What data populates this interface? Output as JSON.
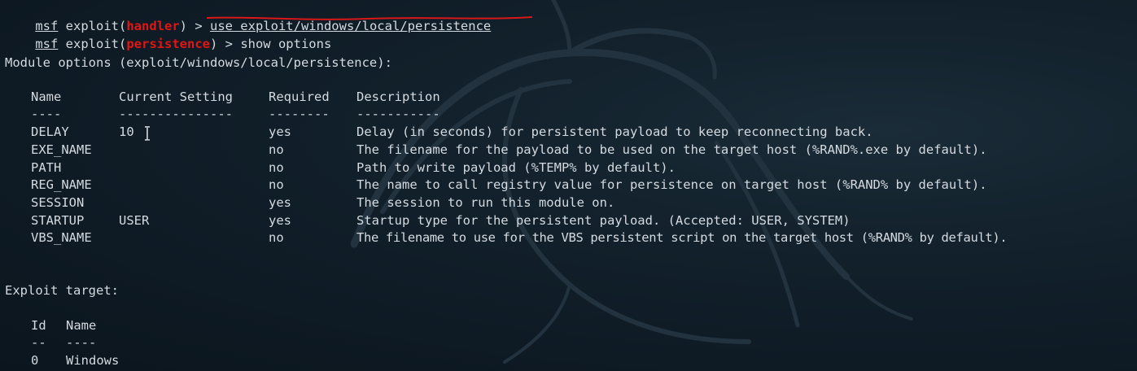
{
  "terminal": {
    "cmd1": {
      "prompt": "msf",
      "pre": " exploit(",
      "module": "handler",
      "post": ") > ",
      "command": "use exploit/windows/local/persistence"
    },
    "cmd2": {
      "prompt": "msf",
      "pre": " exploit(",
      "module": "persistence",
      "post": ") > ",
      "command": "show options"
    },
    "module_options_heading": "Module options (exploit/windows/local/persistence):",
    "options_table": {
      "headers": [
        "Name",
        "Current Setting",
        "Required",
        "Description"
      ],
      "separators": [
        "----",
        "---------------",
        "--------",
        "-----------"
      ],
      "rows": [
        {
          "name": "DELAY",
          "setting": "10",
          "required": "yes",
          "description": "Delay (in seconds) for persistent payload to keep reconnecting back."
        },
        {
          "name": "EXE_NAME",
          "setting": "",
          "required": "no",
          "description": "The filename for the payload to be used on the target host (%RAND%.exe by default)."
        },
        {
          "name": "PATH",
          "setting": "",
          "required": "no",
          "description": "Path to write payload (%TEMP% by default)."
        },
        {
          "name": "REG_NAME",
          "setting": "",
          "required": "no",
          "description": "The name to call registry value for persistence on target host (%RAND% by default)."
        },
        {
          "name": "SESSION",
          "setting": "",
          "required": "yes",
          "description": "The session to run this module on."
        },
        {
          "name": "STARTUP",
          "setting": "USER",
          "required": "yes",
          "description": "Startup type for the persistent payload. (Accepted: USER, SYSTEM)"
        },
        {
          "name": "VBS_NAME",
          "setting": "",
          "required": "no",
          "description": "The filename to use for the VBS persistent script on the target host (%RAND% by default)."
        }
      ]
    },
    "exploit_target_heading": "Exploit target:",
    "target_table": {
      "headers": [
        "Id",
        "Name"
      ],
      "separators": [
        "--",
        "----"
      ],
      "rows": [
        {
          "id": "0",
          "name": "Windows"
        }
      ]
    }
  },
  "colors": {
    "background": "#0e1a24",
    "text": "#d4dadf",
    "module_highlight": "#e01616",
    "annotation_underline": "#d81818"
  },
  "icons": {
    "background": "kali-dragon-watermark",
    "pointer": "text-cursor-ibeam-icon"
  }
}
